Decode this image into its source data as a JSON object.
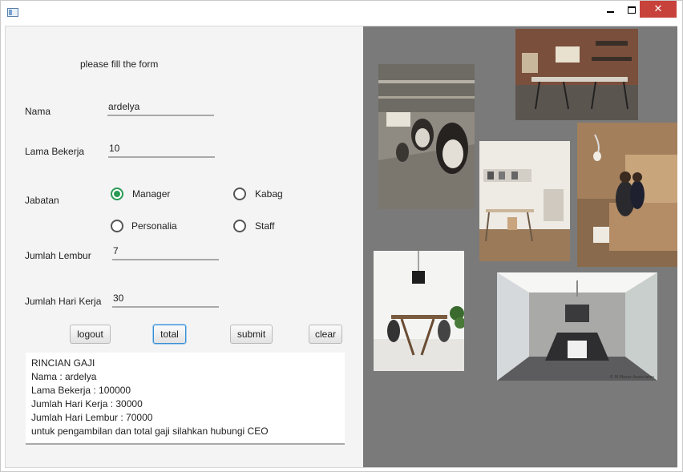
{
  "window": {
    "close_glyph": "✕"
  },
  "form": {
    "heading": "please fill the form",
    "nama": {
      "label": "Nama",
      "value": "ardelya"
    },
    "lama_bekerja": {
      "label": "Lama Bekerja",
      "value": "10"
    },
    "jabatan": {
      "label": "Jabatan",
      "options": [
        "Manager",
        "Kabag",
        "Personalia",
        "Staff"
      ],
      "selected": "Manager"
    },
    "jumlah_lembur": {
      "label": "Jumlah Lembur",
      "value": "7"
    },
    "jumlah_hari_kerja": {
      "label": "Jumlah Hari Kerja",
      "value": "30"
    }
  },
  "buttons": {
    "logout": "logout",
    "total": "total",
    "submit": "submit",
    "clear": "clear"
  },
  "output": {
    "lines": [
      "RINCIAN GAJI",
      "Nama : ardelya",
      "Lama Bekerja : 100000",
      "Jumlah Hari Kerja : 30000",
      "Jumlah Hari Lembur : 70000",
      "untuk pengambilan dan total gaji silahkan hubungi CEO"
    ]
  },
  "images": {
    "caption": "© M Moser Associates"
  },
  "colors": {
    "accent_green": "#2a9a55",
    "close_red": "#c7423b",
    "image_panel_bg": "#7a7a7a"
  }
}
